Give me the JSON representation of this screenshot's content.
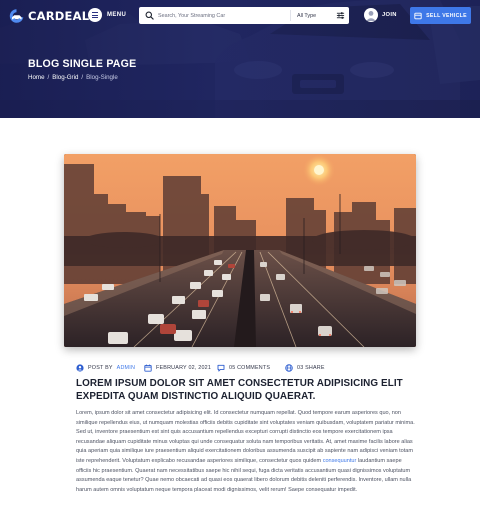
{
  "brand": {
    "name": "CARDEAL",
    "accent": "#3e78e8",
    "navy": "#242a63"
  },
  "topbar": {
    "menu_label": "MENU",
    "search_placeholder": "Search, Your Streaming Car",
    "search_type": "All Type",
    "join_label": "JOIN",
    "sell_label": "SELL VEHICLE"
  },
  "icons": {
    "logo": "car-logo-icon",
    "menu": "hamburger-icon",
    "search": "search-icon",
    "filter": "sliders-icon",
    "avatar": "user-avatar-icon",
    "sell": "vehicle-icon",
    "author": "user-icon",
    "date": "calendar-icon",
    "comments": "comment-icon",
    "share": "globe-icon"
  },
  "hero": {
    "title": "BLOG SINGLE PAGE",
    "breadcrumb": [
      {
        "label": "Home"
      },
      {
        "label": "Blog-Grid"
      },
      {
        "label": "Blog-Single"
      }
    ],
    "separator": "/"
  },
  "article": {
    "meta": {
      "posted_by_prefix": "POST BY",
      "author": "ADMIN",
      "date": "FEBRUARY 02, 2021",
      "comments": "05 COMMENTS",
      "shares": "03 SHARE"
    },
    "headline": "LOREM IPSUM DOLOR SIT AMET CONSECTETUR ADIPISICING ELIT EXPEDITA QUAM DISTINCTIO ALIQUID QUAERAT.",
    "body_before_link": "Lorem, ipsum dolor sit amet consectetur adipisicing elit. Id consectetur numquam repellat. Quod tempore earum asperiores quo, non similique repellendus eius, ut numquam molestias officiis debitis cupiditate sint voluptates veniam quibusdam, voluptatem pariatur minima. Sed ut, inventore praesentium est sint quis accusantium repellendus excepturi corrupti distinctio eos tempore exercitationem ipsa recusandae aliquam cupiditate minus voluptas qui unde consequatur soluta nam temporibus veritatis. At, amet maxime facilis labore alias quia aperiam quia similique iure praesentium aliquid exercitationem doloribus assumenda suscipit ab sapiente nam adipisci veniam totam iste reprehenderit. Voluptatum explicabo recusandae asperiores similique, consectetur quos quidem",
    "body_link": "consequuntur",
    "body_after_link": "laudantium saepe officiis hic praesentium. Quaerat nam necessitatibus saepe hic nihil sequi, fuga dicta veritatis accusantium quasi dignissimos voluptatum assumenda eaque tenetur? Quae nemo obcaecati ad quasi eos quaerat libero dolorum debitis deleniti perferendis. Inventore, ullam nulla harum autem omnis voluptatum neque tempora placeat modi dignissimos, velit rerum! Saepe consequatur impedit."
  }
}
